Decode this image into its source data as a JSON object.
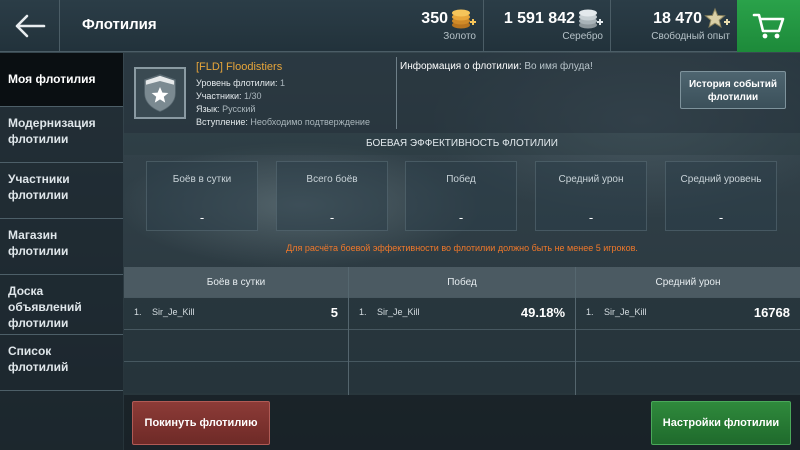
{
  "header": {
    "title": "Флотилия",
    "back_icon": "arrow-left-icon",
    "currencies": [
      {
        "amount": "350",
        "label": "Золото",
        "icon": "gold-coins-icon"
      },
      {
        "amount": "1 591 842",
        "label": "Серебро",
        "icon": "silver-coins-icon"
      },
      {
        "amount": "18 470",
        "label": "Свободный опыт",
        "icon": "star-xp-icon"
      }
    ],
    "cart_icon": "shopping-cart-icon"
  },
  "sidebar": {
    "items": [
      {
        "label": "Моя флотилия",
        "active": true
      },
      {
        "label": "Модернизация\nфлотилии"
      },
      {
        "label": "Участники\nфлотилии"
      },
      {
        "label": "Магазин\nфлотилии"
      },
      {
        "label": "Доска\nобъявлений\nфлотилии"
      },
      {
        "label": "Список\nфлотилий"
      }
    ]
  },
  "fleet": {
    "name": "[FLD] Floodistiers",
    "level_label": "Уровень флотилии:",
    "level_value": "1",
    "members_label": "Участники:",
    "members_value": "1/30",
    "language_label": "Язык:",
    "language_value": "Русский",
    "join_label": "Вступление:",
    "join_value": "Необходимо подтверждение",
    "info_label": "Информация о флотилии:",
    "info_value": "Во имя флуда!",
    "history_button": "История событий\nфлотилии"
  },
  "efficiency": {
    "title": "БОЕВАЯ ЭФФЕКТИВНОСТЬ ФЛОТИЛИИ",
    "stats": [
      {
        "label": "Боёв в сутки",
        "value": "-"
      },
      {
        "label": "Всего боёв",
        "value": "-"
      },
      {
        "label": "Побед",
        "value": "-"
      },
      {
        "label": "Средний урон",
        "value": "-"
      },
      {
        "label": "Средний уровень",
        "value": "-"
      }
    ],
    "warning": "Для расчёта боевой эффективности во флотилии должно быть не менее 5 игроков."
  },
  "leaderboard": {
    "columns": [
      {
        "header": "Боёв в сутки",
        "rows": [
          {
            "rank": "1.",
            "name": "Sir_Je_Kill",
            "score": "5"
          }
        ]
      },
      {
        "header": "Побед",
        "rows": [
          {
            "rank": "1.",
            "name": "Sir_Je_Kill",
            "score": "49.18%"
          }
        ]
      },
      {
        "header": "Средний урон",
        "rows": [
          {
            "rank": "1.",
            "name": "Sir_Je_Kill",
            "score": "16768"
          }
        ]
      }
    ]
  },
  "footer": {
    "leave_button": "Покинуть флотилию",
    "settings_button": "Настройки флотилии"
  },
  "colors": {
    "accent_orange": "#e7a53a",
    "warning": "#f0782a",
    "cart_green": "#2aa24a",
    "leave_red": "#8c3b37",
    "settings_green": "#2f8a3c"
  }
}
